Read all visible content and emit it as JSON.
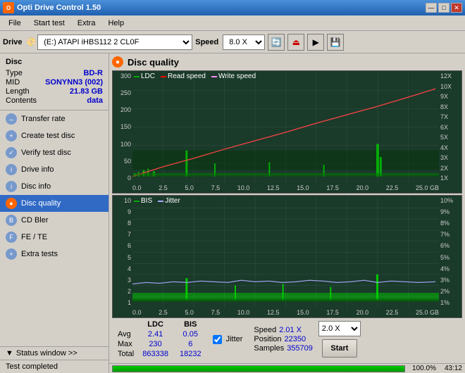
{
  "app": {
    "title": "Opti Drive Control 1.50",
    "icon": "O"
  },
  "titleButtons": [
    "—",
    "□",
    "✕"
  ],
  "menu": {
    "items": [
      "File",
      "Start test",
      "Extra",
      "Help"
    ]
  },
  "toolbar": {
    "driveLabel": "Drive",
    "driveValue": "(E:)  ATAPI iHBS112  2 CL0F",
    "speedLabel": "Speed",
    "speedValue": "8.0 X"
  },
  "disc": {
    "sectionTitle": "Disc",
    "rows": [
      {
        "label": "Type",
        "value": "BD-R"
      },
      {
        "label": "MID",
        "value": "SONYNN3 (002)"
      },
      {
        "label": "Length",
        "value": "21.83 GB"
      },
      {
        "label": "Contents",
        "value": "data"
      }
    ]
  },
  "sidebarButtons": [
    {
      "id": "transfer-rate",
      "label": "Transfer rate"
    },
    {
      "id": "create-test-disc",
      "label": "Create test disc"
    },
    {
      "id": "verify-test-disc",
      "label": "Verify test disc"
    },
    {
      "id": "drive-info",
      "label": "Drive info"
    },
    {
      "id": "disc-info",
      "label": "Disc info"
    },
    {
      "id": "disc-quality",
      "label": "Disc quality",
      "active": true
    },
    {
      "id": "cd-bler",
      "label": "CD Bler"
    },
    {
      "id": "fe-te",
      "label": "FE / TE"
    },
    {
      "id": "extra-tests",
      "label": "Extra tests"
    }
  ],
  "statusWindow": {
    "label": "Status window >>",
    "testCompleted": "Test completed"
  },
  "discQuality": {
    "title": "Disc quality",
    "legend": {
      "ldc": "LDC",
      "readSpeed": "Read speed",
      "writeSpeed": "Write speed"
    },
    "chart1": {
      "yLeft": [
        "300",
        "250",
        "200",
        "150",
        "100",
        "50",
        "0"
      ],
      "yRight": [
        "12X",
        "10X",
        "9X",
        "8X",
        "7X",
        "6X",
        "5X",
        "4X",
        "3X",
        "2X",
        "1X"
      ],
      "xAxis": [
        "0.0",
        "2.5",
        "5.0",
        "7.5",
        "10.0",
        "12.5",
        "15.0",
        "17.5",
        "20.0",
        "22.5",
        "25.0 GB"
      ]
    },
    "chart2": {
      "legend": {
        "bis": "BIS",
        "jitter": "Jitter"
      },
      "yLeft": [
        "10",
        "9",
        "8",
        "7",
        "6",
        "5",
        "4",
        "3",
        "2",
        "1"
      ],
      "yRight": [
        "10%",
        "9%",
        "8%",
        "7%",
        "6%",
        "5%",
        "4%",
        "3%",
        "2%",
        "1%"
      ],
      "xAxis": [
        "0.0",
        "2.5",
        "5.0",
        "7.5",
        "10.0",
        "12.5",
        "15.0",
        "17.5",
        "20.0",
        "22.5",
        "25.0 GB"
      ]
    }
  },
  "stats": {
    "headers": [
      "",
      "LDC",
      "BIS"
    ],
    "rows": [
      {
        "label": "Avg",
        "ldc": "2.41",
        "bis": "0.05"
      },
      {
        "label": "Max",
        "ldc": "230",
        "bis": "6"
      },
      {
        "label": "Total",
        "ldc": "863338",
        "bis": "18232"
      }
    ],
    "jitterLabel": "Jitter",
    "jitterChecked": true,
    "speed": {
      "label": "Speed",
      "value": "2.01 X",
      "position": "22350",
      "samples": "355709"
    },
    "speedSelect": "2.0 X"
  },
  "progress": {
    "percent": "100.0%",
    "fillWidth": "100",
    "time": "43:12"
  }
}
